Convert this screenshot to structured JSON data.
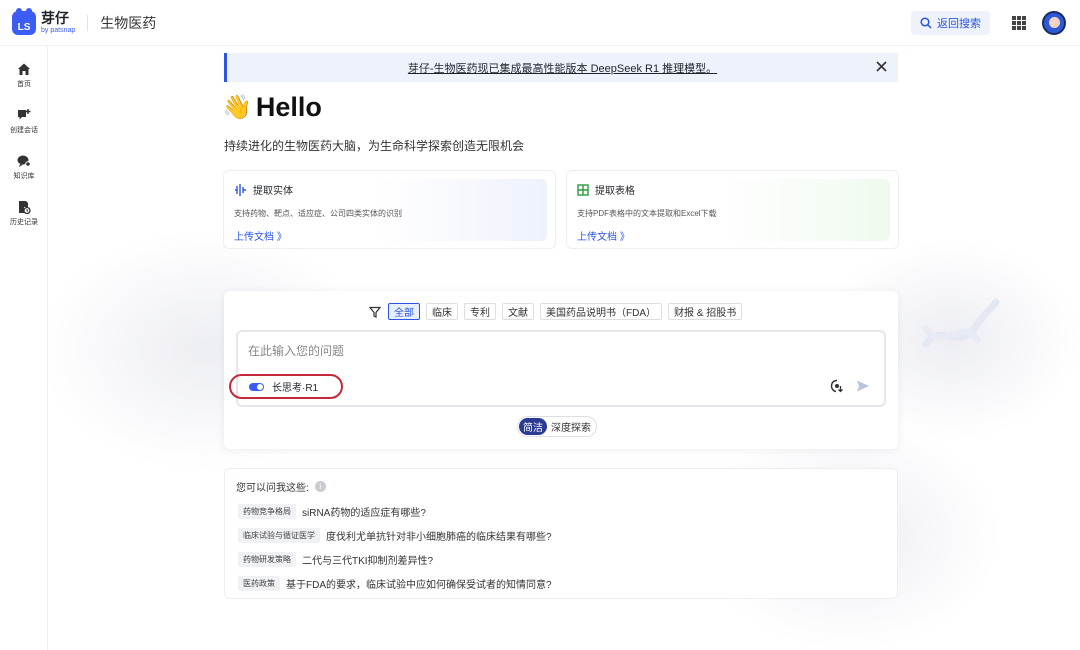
{
  "header": {
    "logo_badge": "LS",
    "logo_name": "芽仔",
    "logo_sub": "by patsnap",
    "title": "生物医药",
    "back_search": "返回搜索"
  },
  "sidebar": {
    "items": [
      {
        "label": "首页",
        "icon": "home-icon"
      },
      {
        "label": "创建会话",
        "icon": "new-chat-icon"
      },
      {
        "label": "知识库",
        "icon": "knowledge-icon"
      },
      {
        "label": "历史记录",
        "icon": "history-icon"
      }
    ]
  },
  "notice": {
    "text": "芽仔-生物医药现已集成最高性能版本 DeepSeek R1 推理模型。"
  },
  "hero": {
    "emoji": "👋",
    "title": "Hello",
    "subtitle": "持续进化的生物医药大脑，为生命科学探索创造无限机会"
  },
  "cards": [
    {
      "title": "提取实体",
      "desc": "支持药物、靶点、适应症、公司四类实体的识别",
      "link": "上传文档 》",
      "icon": "entity-icon",
      "accent": "#2a55e5"
    },
    {
      "title": "提取表格",
      "desc": "支持PDF表格中的文本提取和Excel下载",
      "link": "上传文档 》",
      "icon": "table-icon",
      "accent": "#2e9a3c"
    }
  ],
  "search": {
    "filters": [
      "全部",
      "临床",
      "专利",
      "文献",
      "美国药品说明书（FDA）",
      "财报 & 招股书"
    ],
    "active_filter": "全部",
    "placeholder": "在此输入您的问题",
    "deep_think_label": "长思考·R1",
    "deep_think_on": true,
    "modes": [
      "简洁",
      "深度探索"
    ],
    "active_mode": "简洁"
  },
  "suggestions": {
    "heading": "您可以问我这些:",
    "items": [
      {
        "tag": "药物竞争格局",
        "question": "siRNA药物的适应症有哪些?"
      },
      {
        "tag": "临床试验与循证医学",
        "question": "度伐利尤单抗针对非小细胞肺癌的临床结果有哪些?"
      },
      {
        "tag": "药物研发策略",
        "question": "二代与三代TKI抑制剂差异性?"
      },
      {
        "tag": "医药政策",
        "question": "基于FDA的要求，临床试验中应如何确保受试者的知情同意?"
      }
    ]
  },
  "colors": {
    "primary": "#2a55e5",
    "dark_mode_btn": "#2b3b8f",
    "highlight_ring": "#c5283a"
  }
}
